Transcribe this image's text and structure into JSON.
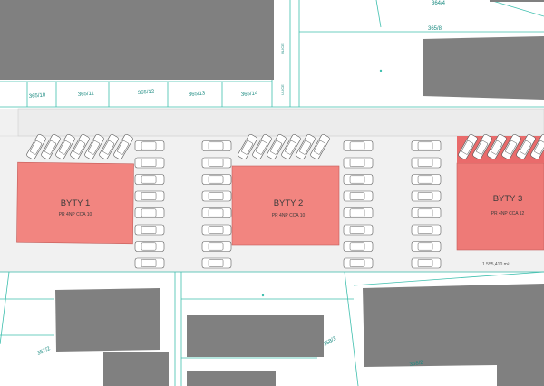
{
  "map": {
    "buildings_new": [
      {
        "label": "BYTY 1",
        "sublabel": "PR 4NP CCA 10"
      },
      {
        "label": "BYTY 2",
        "sublabel": "PR 4NP CCA 10"
      },
      {
        "label": "BYTY 3",
        "sublabel": "PR 4NP CCA 12"
      }
    ],
    "parcel_labels": [
      "364/4",
      "365/8",
      "365/10",
      "365/11",
      "365/12",
      "365/13",
      "365/14",
      "357/2",
      "358/3",
      "358/2"
    ],
    "street_labels": [
      "ULICE",
      "ULICE"
    ],
    "area_label": "1 555,410 m²",
    "colors": {
      "building_existing": "#808080",
      "building_new_1": "#f28580",
      "building_new_3": "#ee7a77",
      "cadastral_line": "#3fbfae",
      "road": "#f0f0f0",
      "parking_highlight": "#e96b6b"
    }
  }
}
